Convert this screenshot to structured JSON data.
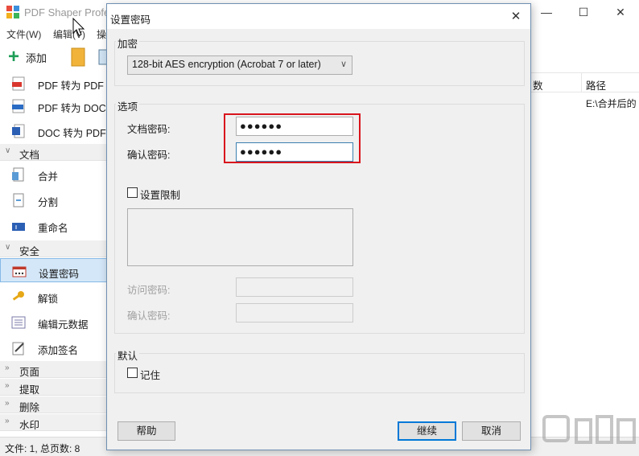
{
  "app": {
    "title": "PDF Shaper Profe",
    "window_controls": {
      "minimize": "—",
      "maximize": "☐",
      "close": "✕"
    }
  },
  "menu": [
    "文件(W)",
    "编辑(V)",
    "操"
  ],
  "toolbar": {
    "add_label": "添加"
  },
  "sidebar": {
    "convert_items": [
      "PDF 转为 PDF",
      "PDF 转为 DOC",
      "DOC 转为 PDF"
    ],
    "document_cat": "文档",
    "document_items": [
      "合并",
      "分割",
      "重命名"
    ],
    "security_cat": "安全",
    "security_items": [
      "设置密码",
      "解锁",
      "编辑元数据",
      "添加签名"
    ],
    "collapsed_cats": [
      "页面",
      "提取",
      "删除",
      "水印"
    ]
  },
  "table": {
    "col_count": "数",
    "col_path": "路径",
    "row_path": "E:\\合并后的"
  },
  "status": {
    "text": "文件: 1, 总页数: 8"
  },
  "dialog": {
    "title": "设置密码",
    "close": "✕",
    "encryption": {
      "group_label": "加密",
      "selected": "128-bit AES encryption (Acrobat 7 or later)"
    },
    "options": {
      "group_label": "选项",
      "doc_password_label": "文档密码:",
      "doc_password_value": "●●●●●●",
      "confirm_password_label": "确认密码:",
      "confirm_password_value": "●●●●●●",
      "restrict_label": "设置限制",
      "restrict_checked": false,
      "access_password_label": "访问密码:",
      "access_confirm_label": "确认密码:"
    },
    "default": {
      "group_label": "默认",
      "remember_label": "记住",
      "remember_checked": false
    },
    "buttons": {
      "help": "帮助",
      "continue": "继续",
      "cancel": "取消"
    }
  },
  "colors": {
    "highlight": "#d9141c",
    "selection": "#d4e7f8",
    "accent": "#0078d7"
  }
}
